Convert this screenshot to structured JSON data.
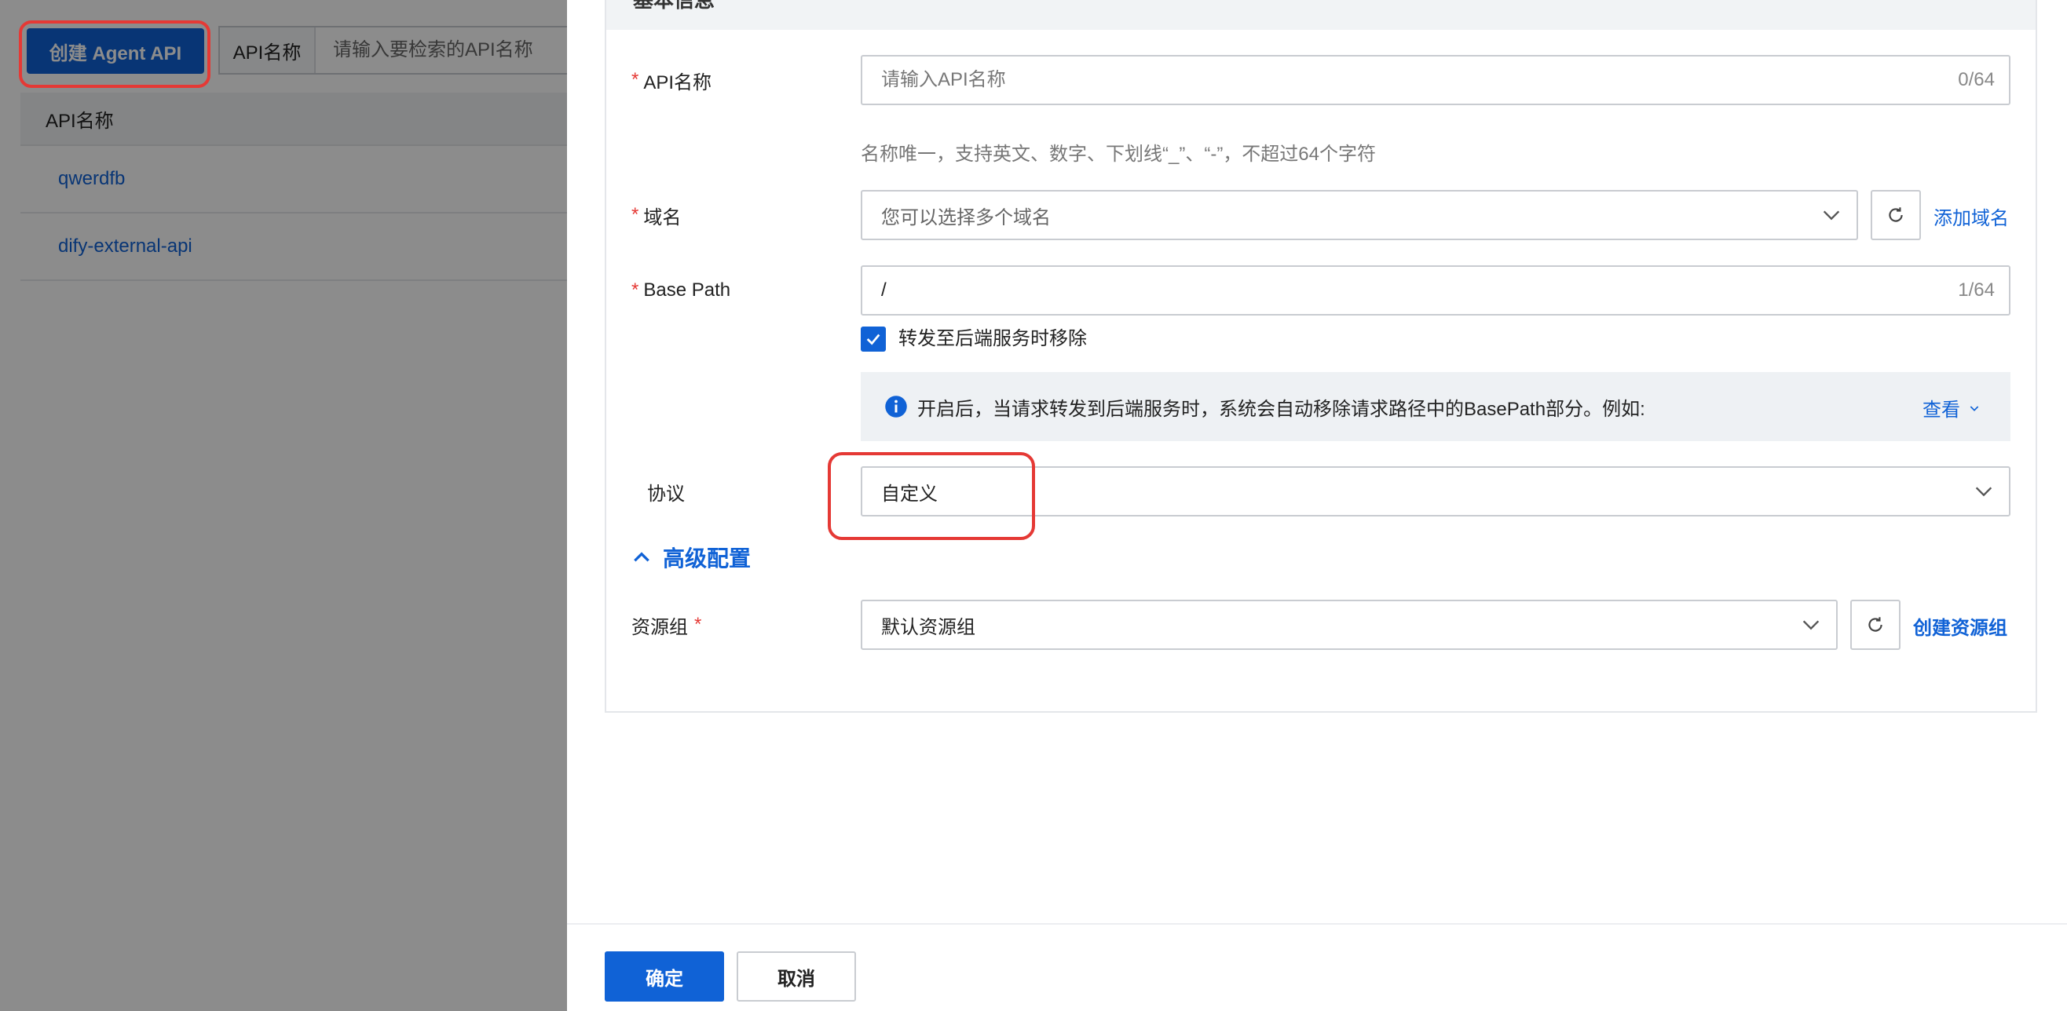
{
  "list_page": {
    "create_button": "创建 Agent API",
    "search_type": "API名称",
    "search_placeholder": "请输入要检索的API名称",
    "table_header": "API名称",
    "rows": [
      "qwerdfb",
      "dify-external-api"
    ]
  },
  "drawer": {
    "section_title": "基本信息",
    "api_name": {
      "label": "API名称",
      "placeholder": "请输入API名称",
      "counter": "0/64",
      "help": "名称唯一，支持英文、数字、下划线“_”、“-”，不超过64个字符"
    },
    "domain": {
      "label": "域名",
      "placeholder": "您可以选择多个域名",
      "add_link": "添加域名"
    },
    "base_path": {
      "label": "Base Path",
      "value": "/",
      "counter": "1/64",
      "checkbox_label": "转发至后端服务时移除",
      "checkbox_checked": true,
      "info_text": "开启后，当请求转发到后端服务时，系统会自动移除请求路径中的BasePath部分。例如:",
      "info_link": "查看"
    },
    "protocol": {
      "label": "协议",
      "value": "自定义"
    },
    "advanced": {
      "toggle_label": "高级配置",
      "expanded": true
    },
    "resource_group": {
      "label": "资源组",
      "value": "默认资源组",
      "create_link": "创建资源组"
    },
    "footer": {
      "ok": "确定",
      "cancel": "取消"
    }
  },
  "colors": {
    "primary": "#1062d6",
    "required": "#e53935",
    "highlight_outline": "#e53935"
  }
}
